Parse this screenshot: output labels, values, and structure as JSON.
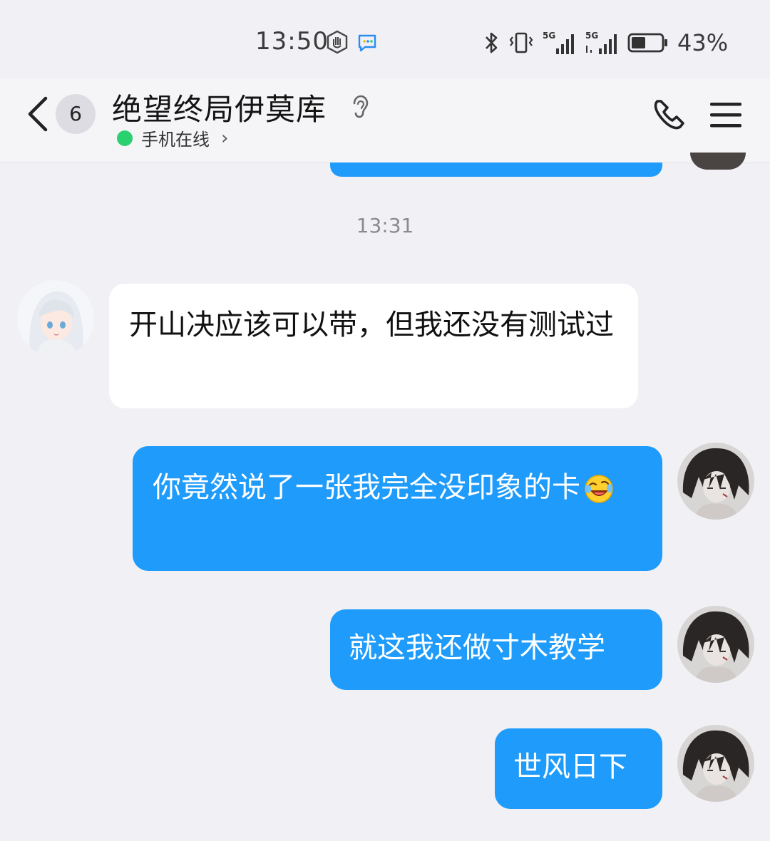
{
  "status_bar": {
    "time": "13:50",
    "battery_percent": "43%",
    "network_labels": [
      "5G",
      "5G"
    ]
  },
  "header": {
    "unread_count": "6",
    "contact_name": "绝望终局伊莫库",
    "presence": "手机在线",
    "presence_chevron": "›"
  },
  "chat": {
    "timestamp": "13:31",
    "messages": [
      {
        "direction": "incoming",
        "text": "开山决应该可以带，但我还没有测试过"
      },
      {
        "direction": "outgoing",
        "text": "你竟然说了一张我完全没印象的卡",
        "emoji": "laughing-crying-emoji"
      },
      {
        "direction": "outgoing",
        "text": "就这我还做寸木教学"
      },
      {
        "direction": "outgoing",
        "text": "世风日下"
      }
    ]
  },
  "colors": {
    "background": "#f0f0f5",
    "outgoing_bubble": "#1e9bfb",
    "incoming_bubble": "#ffffff",
    "online_dot": "#2bd16f"
  }
}
